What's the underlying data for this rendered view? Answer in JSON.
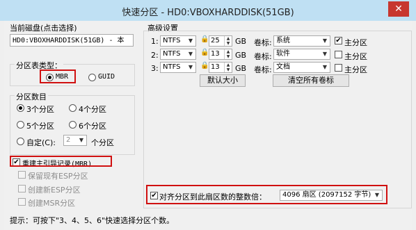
{
  "window": {
    "title": "快速分区 - HD0:VBOXHARDDISK(51GB)",
    "close": "✕"
  },
  "disk": {
    "caption": "当前磁盘(点击选择)",
    "value": "HD0:VBOXHARDDISK(51GB) - 本"
  },
  "table_type": {
    "caption": "分区表类型：",
    "mbr": "MBR",
    "guid": "GUID",
    "selected": "MBR"
  },
  "count": {
    "caption": "分区数目",
    "opt3": "3个分区",
    "opt4": "4个分区",
    "opt5": "5个分区",
    "opt6": "6个分区",
    "custom": "自定(C):",
    "custom_value": "2",
    "custom_unit": "个分区",
    "selected": "3个分区"
  },
  "options": {
    "rebuild_mbr": "重建主引导记录(MBR)",
    "keep_esp": "保留现有ESP分区",
    "create_esp": "创建新ESP分区",
    "create_msr": "创建MSR分区"
  },
  "advanced": {
    "caption": "高级设置",
    "rows": [
      {
        "num": "1:",
        "fs": "NTFS",
        "size": "25",
        "unit": "GB",
        "label_cap": "卷标:",
        "label": "系统",
        "primary": "主分区",
        "primary_checked": true
      },
      {
        "num": "2:",
        "fs": "NTFS",
        "size": "13",
        "unit": "GB",
        "label_cap": "卷标:",
        "label": "软件",
        "primary": "主分区",
        "primary_checked": false
      },
      {
        "num": "3:",
        "fs": "NTFS",
        "size": "13",
        "unit": "GB",
        "label_cap": "卷标:",
        "label": "文档",
        "primary": "主分区",
        "primary_checked": false
      }
    ],
    "default_size": "默认大小",
    "clear_labels": "清空所有卷标"
  },
  "align": {
    "label": "对齐分区到此扇区数的整数倍：",
    "value": "4096 扇区 (2097152 字节)"
  },
  "hint": {
    "line1": "提示：可按下\"3、4、5、6\"快速选择分区个数。"
  },
  "colors": {
    "title_bar": "#bfe0f3",
    "highlight_red": "#d01010",
    "close_red": "#c7372f"
  }
}
